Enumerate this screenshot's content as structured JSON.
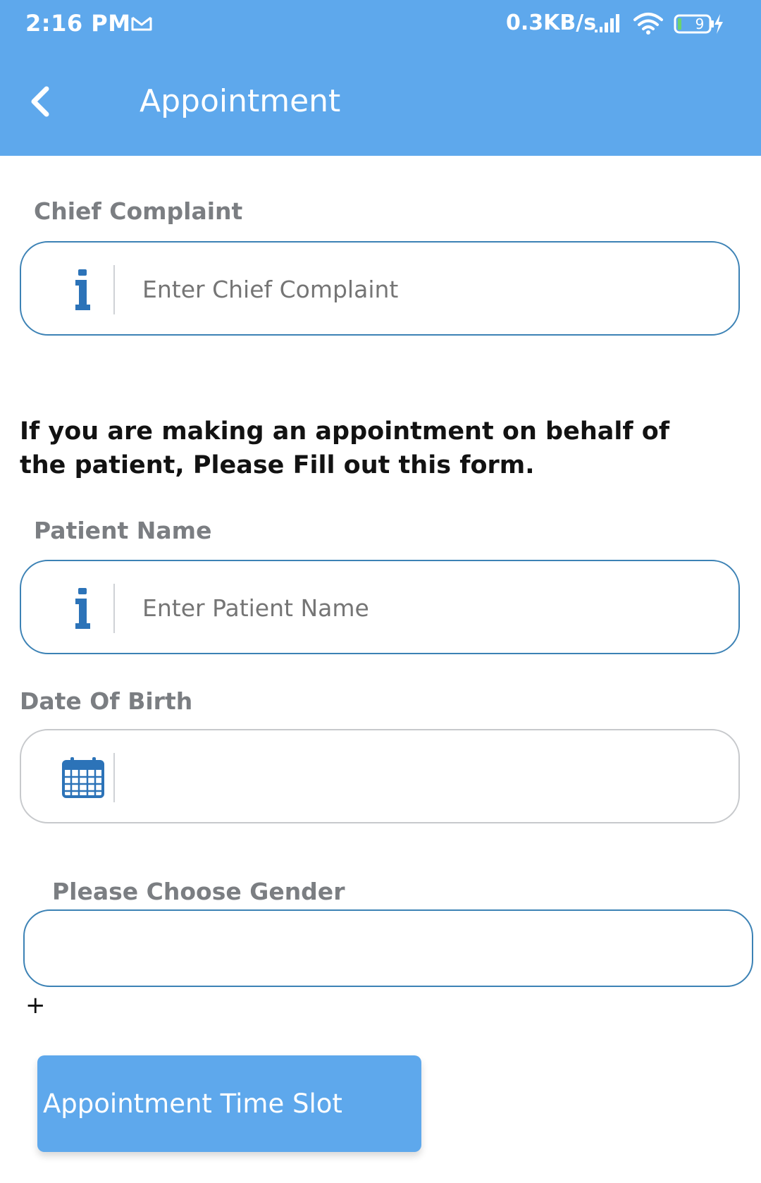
{
  "status_bar": {
    "time": "2:16 PM",
    "network_speed": "0.3KB/s",
    "battery_level": "9",
    "icons": [
      "gmail-icon",
      "signal-icon",
      "wifi-icon",
      "battery-icon",
      "charging-icon"
    ]
  },
  "header": {
    "back_icon": "chevron-left-icon",
    "title": "Appointment"
  },
  "chief_complaint": {
    "label": "Chief Complaint",
    "placeholder": "Enter Chief Complaint",
    "value": "",
    "icon": "info-icon"
  },
  "instructions": "If you are making an appointment on behalf of the patient, Please Fill out this form.",
  "patient_name": {
    "label": "Patient Name",
    "placeholder": "Enter Patient Name",
    "value": "",
    "icon": "info-icon"
  },
  "date_of_birth": {
    "label": "Date Of Birth",
    "value": "",
    "icon": "calendar-icon"
  },
  "gender": {
    "label": "Please Choose Gender",
    "selected": ""
  },
  "add_symbol": "+",
  "time_slot_button": {
    "label": "Appointment Time Slot"
  },
  "colors": {
    "primary": "#5ea8ec",
    "input_border": "#3c82b5",
    "icon": "#2c73b8",
    "label_grey": "#7b7e82"
  }
}
